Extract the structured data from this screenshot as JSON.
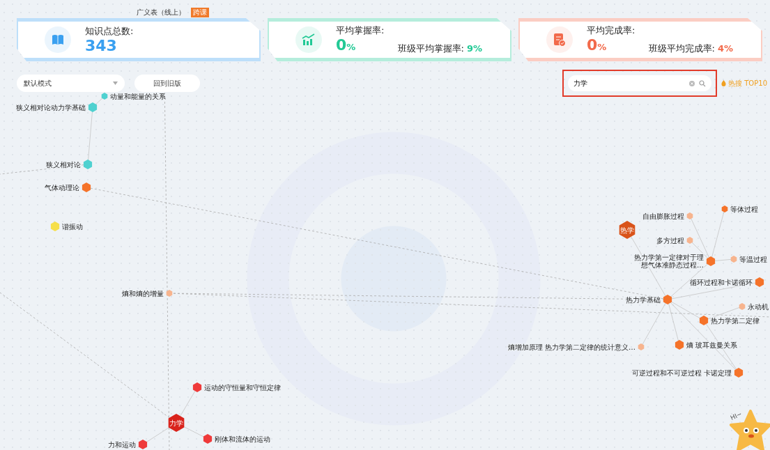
{
  "top_node": {
    "label": "广义表（线上）",
    "badge": "跨课"
  },
  "stats": [
    {
      "kind": "count",
      "title": "知识点总数:",
      "value": "343",
      "color": "#3aa0f0"
    },
    {
      "kind": "rate",
      "title": "平均掌握率:",
      "value": "0",
      "unit": "%",
      "class_label": "班级平均掌握率:",
      "class_value": "9%",
      "color": "#22c995"
    },
    {
      "kind": "rate",
      "title": "平均完成率:",
      "value": "0",
      "unit": "%",
      "class_label": "班级平均完成率:",
      "class_value": "4%",
      "color": "#f26a4b"
    }
  ],
  "mode_select": {
    "value": "默认模式"
  },
  "old_version_button": "回到旧版",
  "search": {
    "value": "力学"
  },
  "hot_search": "热搜 TOP10",
  "graph": {
    "nodes": [
      {
        "label": "动量和能量的关系",
        "color": "#4fd1d0",
        "kind": "small"
      },
      {
        "label": "狭义相对论动力学基础",
        "color": "#4fd1d0",
        "kind": "medium"
      },
      {
        "label": "狭义相对论",
        "color": "#4fd1d0",
        "kind": "medium"
      },
      {
        "label": "气体动理论",
        "color": "#f5732a",
        "kind": "medium"
      },
      {
        "label": "等体过程",
        "color": "#f5732a",
        "kind": "small"
      },
      {
        "label": "自由膨胀过程",
        "color": "#f7b48e",
        "kind": "small"
      },
      {
        "label": "谐振动",
        "color": "#f6df4a",
        "kind": "medium"
      },
      {
        "label": "热学",
        "color": "#d9531a",
        "kind": "large"
      },
      {
        "label": "多方过程",
        "color": "#f7b48e",
        "kind": "small"
      },
      {
        "label": "热力学第一定律对于理想气体准静态过程…",
        "color": "#f5732a",
        "kind": "medium"
      },
      {
        "label": "等温过程",
        "color": "#f7b48e",
        "kind": "small"
      },
      {
        "label": "循环过程和卡诺循环",
        "color": "#f5732a",
        "kind": "medium"
      },
      {
        "label": "熵和熵的增量",
        "color": "#f7b48e",
        "kind": "small"
      },
      {
        "label": "热力学基础",
        "color": "#f5732a",
        "kind": "medium"
      },
      {
        "label": "永动机",
        "color": "#f7b48e",
        "kind": "small"
      },
      {
        "label": "热力学第二定律",
        "color": "#f5732a",
        "kind": "medium"
      },
      {
        "label": "熵增加原理 热力学第二定律的统计意义…",
        "color": "#f7b48e",
        "kind": "small"
      },
      {
        "label": "熵 玻耳兹曼关系",
        "color": "#f5732a",
        "kind": "medium"
      },
      {
        "label": "可逆过程和不可逆过程 卡诺定理",
        "color": "#f5732a",
        "kind": "medium"
      },
      {
        "label": "运动的守恒量和守恒定律",
        "color": "#ef3a3a",
        "kind": "medium"
      },
      {
        "label": "力学",
        "color": "#d9231c",
        "kind": "large"
      },
      {
        "label": "刚体和流体的运动",
        "color": "#ef3a3a",
        "kind": "medium"
      },
      {
        "label": "力和运动",
        "color": "#ef3a3a",
        "kind": "medium"
      }
    ]
  },
  "mascot": {
    "greeting": "HI~"
  }
}
